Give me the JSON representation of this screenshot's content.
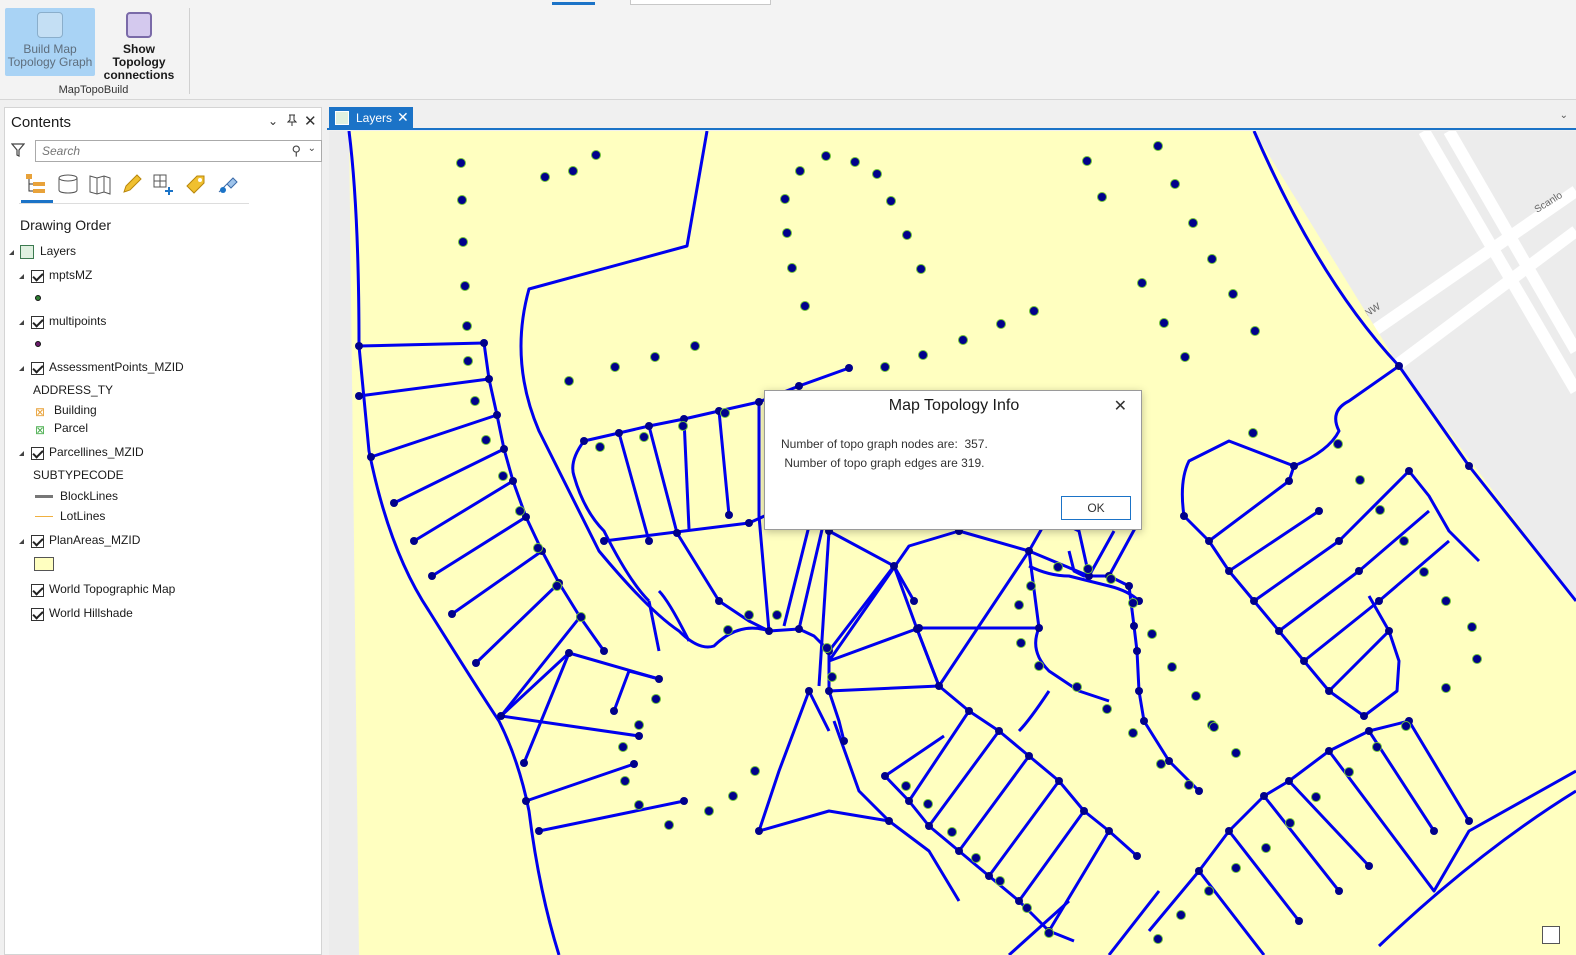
{
  "ribbon": {
    "build_button_label": "Build Map Topology Graph",
    "show_button_label": "Show Topology connections",
    "group_label": "MapTopoBuild"
  },
  "contents": {
    "title": "Contents",
    "search_placeholder": "Search",
    "drawing_order_label": "Drawing Order",
    "layers_root": "Layers",
    "items": {
      "mpts": "mptsMZ",
      "multipoints": "multipoints",
      "assessment": "AssessmentPoints_MZID",
      "assessment_field": "ADDRESS_TY",
      "assessment_building": "Building",
      "assessment_parcel": "Parcel",
      "parcellines": "Parcellines_MZID",
      "parcellines_field": "SUBTYPECODE",
      "blocklines": "BlockLines",
      "lotlines": "LotLines",
      "planareas": "PlanAreas_MZID",
      "topo": "World Topographic Map",
      "hillshade": "World Hillshade"
    }
  },
  "map_tab": {
    "label": "Layers"
  },
  "map": {
    "street_label_1": "Scanlo",
    "street_label_2": "NW"
  },
  "dialog": {
    "title": "Map Topology Info",
    "line1": "Number of topo graph nodes are:  357.",
    "line2": " Number of topo graph edges are 319.",
    "ok_label": "OK"
  },
  "colors": {
    "accent": "#1b73c7",
    "parcel_fill": "#ffffc0",
    "topology_line": "#0000ee",
    "topology_node": "#00008b",
    "point_halo": "#6fbf3a"
  }
}
